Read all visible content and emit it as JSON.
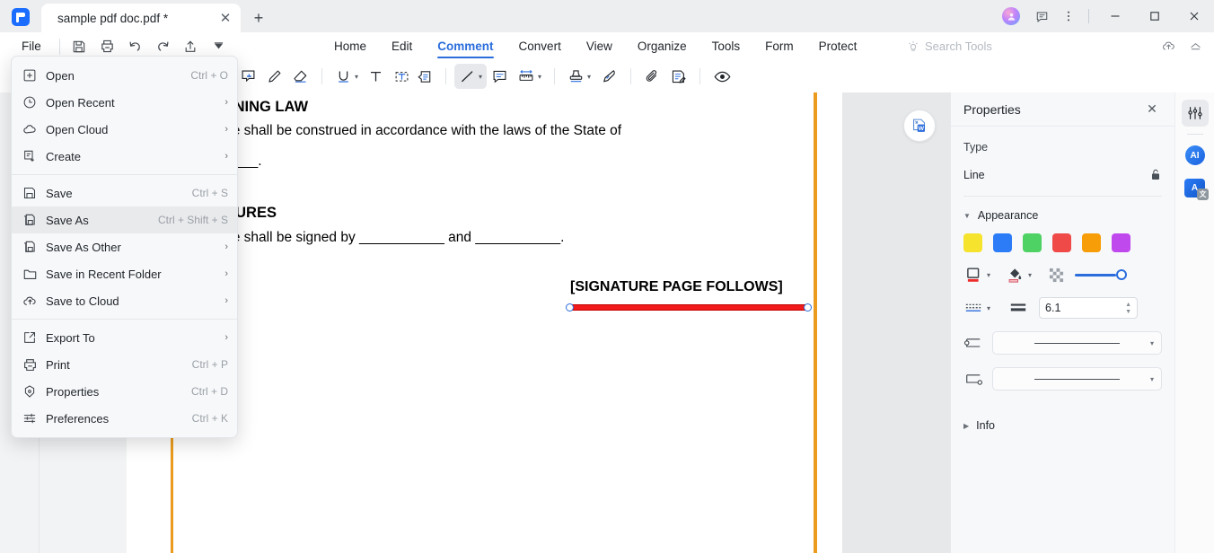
{
  "window": {
    "tab_title": "sample pdf doc.pdf *",
    "new_tab_label": "+",
    "close_tab_label": "✕",
    "minimize_label": "—",
    "maximize_label": "☐",
    "close_label": "✕"
  },
  "menubar": {
    "file_label": "File",
    "items": [
      {
        "label": "Home",
        "active": false
      },
      {
        "label": "Edit",
        "active": false
      },
      {
        "label": "Comment",
        "active": true
      },
      {
        "label": "Convert",
        "active": false
      },
      {
        "label": "View",
        "active": false
      },
      {
        "label": "Organize",
        "active": false
      },
      {
        "label": "Tools",
        "active": false
      },
      {
        "label": "Form",
        "active": false
      },
      {
        "label": "Protect",
        "active": false
      }
    ],
    "search_placeholder": "Search Tools"
  },
  "quick_access": [
    "save-icon",
    "print-icon",
    "undo-icon",
    "redo-icon",
    "share-icon",
    "more-icon"
  ],
  "toolbar": {
    "tools": [
      "note-icon",
      "pencil-icon",
      "eraser-icon",
      "underline-icon",
      "text-icon",
      "textbox-icon",
      "callout-icon",
      "line-icon",
      "comment-icon",
      "measure-icon",
      "stamp-icon",
      "signature-icon",
      "attachment-icon",
      "summary-icon",
      "show-hide-icon"
    ],
    "selected": "line-icon"
  },
  "file_menu": {
    "groups": [
      [
        {
          "label": "Open",
          "shortcut": "Ctrl + O",
          "icon": "plus-square-icon",
          "submenu": false,
          "highlight": false
        },
        {
          "label": "Open Recent",
          "shortcut": "",
          "icon": "clock-icon",
          "submenu": true,
          "highlight": false
        },
        {
          "label": "Open Cloud",
          "shortcut": "",
          "icon": "cloud-icon",
          "submenu": true,
          "highlight": false
        },
        {
          "label": "Create",
          "shortcut": "",
          "icon": "create-doc-icon",
          "submenu": true,
          "highlight": false
        }
      ],
      [
        {
          "label": "Save",
          "shortcut": "Ctrl + S",
          "icon": "floppy-icon",
          "submenu": false,
          "highlight": false
        },
        {
          "label": "Save As",
          "shortcut": "Ctrl + Shift + S",
          "icon": "floppy-stack-icon",
          "submenu": false,
          "highlight": true
        },
        {
          "label": "Save As Other",
          "shortcut": "",
          "icon": "floppy-stack-icon",
          "submenu": true,
          "highlight": false
        },
        {
          "label": "Save in Recent Folder",
          "shortcut": "",
          "icon": "folder-icon",
          "submenu": true,
          "highlight": false
        },
        {
          "label": "Save to Cloud",
          "shortcut": "",
          "icon": "cloud-upload-icon",
          "submenu": true,
          "highlight": false
        }
      ],
      [
        {
          "label": "Export To",
          "shortcut": "",
          "icon": "export-icon",
          "submenu": true,
          "highlight": false
        },
        {
          "label": "Print",
          "shortcut": "Ctrl + P",
          "icon": "printer-icon",
          "submenu": false,
          "highlight": false
        },
        {
          "label": "Properties",
          "shortcut": "Ctrl + D",
          "icon": "properties-icon",
          "submenu": false,
          "highlight": false
        },
        {
          "label": "Preferences",
          "shortcut": "Ctrl + K",
          "icon": "sliders-icon",
          "submenu": false,
          "highlight": false
        }
      ]
    ],
    "submenu_arrow": "›"
  },
  "document": {
    "heading_1": "GOVERNING LAW",
    "para_1": "This Note shall be construed in accordance with the laws of the State of",
    "para_1b": "__________.",
    "heading_2": "SIGNATURES",
    "para_2": "This Note shall be signed by ___________ and ___________.",
    "signature_note": "[SIGNATURE PAGE FOLLOWS]",
    "annotation_color": "#f21b1b",
    "margin_guide_color": "#eb9c1e"
  },
  "properties": {
    "title": "Properties",
    "close_label": "✕",
    "type_label": "Type",
    "type_value": "Line",
    "lock_icon": "lock-icon",
    "appearance_label": "Appearance",
    "appearance_expanded": true,
    "colors": [
      "#f6e32e",
      "#2b7cf6",
      "#4ed264",
      "#ef4a47",
      "#f79d08",
      "#c049ee"
    ],
    "stroke_icon": "stroke-color-icon",
    "fill_icon": "fill-color-icon",
    "transparency_icon": "transparency-icon",
    "opacity_value": 100,
    "line_style_icon": "line-style-icon",
    "line_weight_icon": "line-weight-icon",
    "line_weight_value": "6.1",
    "start_style_icon": "start-arrow-icon",
    "end_style_icon": "end-arrow-icon",
    "start_style_value": "",
    "end_style_value": "",
    "info_label": "Info",
    "info_expanded": false
  },
  "right_rail": {
    "items": [
      {
        "name": "properties-panel-toggle",
        "icon": "sliders-icon",
        "active": true
      },
      {
        "name": "ai-assistant",
        "icon": "ai-icon",
        "label": "AI",
        "active": false
      },
      {
        "name": "translate",
        "icon": "translate-icon",
        "label": "A",
        "active": false
      }
    ]
  },
  "overlay": {
    "convert_badge": "word-convert-icon"
  }
}
